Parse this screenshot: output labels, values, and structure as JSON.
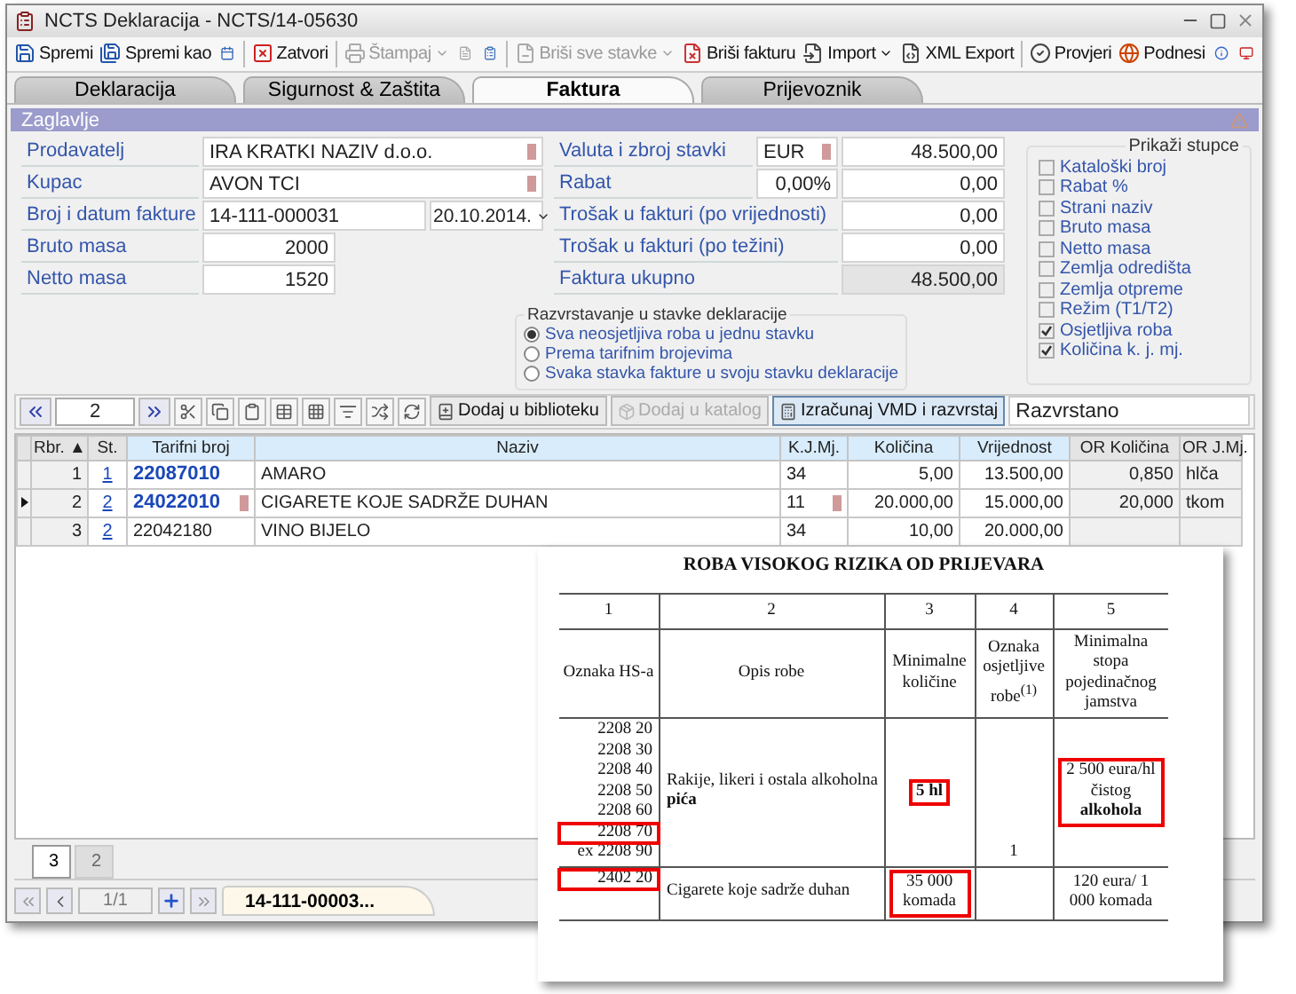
{
  "window": {
    "title": "NCTS Deklaracija - NCTS/14-05630"
  },
  "toolbar": [
    {
      "kind": "button",
      "label": "Spremi",
      "disabled": false,
      "dropdown": false
    },
    {
      "kind": "button",
      "label": "Spremi kao",
      "disabled": false,
      "dropdown": false
    },
    {
      "kind": "icon",
      "disabled": false
    },
    {
      "kind": "separator"
    },
    {
      "kind": "button",
      "label": "Zatvori",
      "disabled": false,
      "dropdown": false
    },
    {
      "kind": "separator"
    },
    {
      "kind": "button",
      "label": "Štampaj",
      "disabled": true,
      "dropdown": true
    },
    {
      "kind": "icon",
      "disabled": true
    },
    {
      "kind": "icon",
      "disabled": false
    },
    {
      "kind": "separator"
    },
    {
      "kind": "button",
      "label": "Briši sve stavke",
      "disabled": true,
      "dropdown": true
    },
    {
      "kind": "button",
      "label": "Briši fakturu",
      "disabled": false,
      "dropdown": false
    },
    {
      "kind": "button",
      "label": "Import",
      "disabled": false,
      "dropdown": true
    },
    {
      "kind": "button",
      "label": "XML Export",
      "disabled": false,
      "dropdown": false
    },
    {
      "kind": "separator"
    },
    {
      "kind": "button",
      "label": "Provjeri",
      "disabled": false,
      "dropdown": false
    },
    {
      "kind": "button",
      "label": "Podnesi",
      "disabled": false,
      "dropdown": false
    },
    {
      "kind": "icon",
      "disabled": false
    },
    {
      "kind": "icon",
      "disabled": false
    }
  ],
  "tabs": [
    {
      "label": "Deklaracija",
      "selected": false
    },
    {
      "label": "Sigurnost & Zaštita",
      "selected": false
    },
    {
      "label": "Faktura",
      "selected": true
    },
    {
      "label": "Prijevoznik",
      "selected": false
    }
  ],
  "section": {
    "title": "Zaglavlje"
  },
  "form": {
    "left": [
      {
        "kind": "text",
        "label": "Prodavatelj",
        "value": "IRA KRATKI NAZIV d.o.o.",
        "marker": true
      },
      {
        "kind": "text",
        "label": "Kupac",
        "value": "AVON TCI",
        "marker": true
      },
      {
        "kind": "dated",
        "label": "Broj i datum fakture",
        "value": "14-111-000031",
        "date": "20.10.2014.",
        "marker": false
      },
      {
        "kind": "number",
        "label": "Bruto masa",
        "value": "2000",
        "marker": false
      },
      {
        "kind": "number",
        "label": "Netto masa",
        "value": "1520",
        "marker": false
      }
    ],
    "right": [
      {
        "label": "Valuta i zbroj stavki",
        "extra": "EUR",
        "value": "48.500,00",
        "marker": true,
        "readonly": false
      },
      {
        "label": "Rabat",
        "extra": "0,00%",
        "value": "0,00",
        "marker": false,
        "readonly": false
      },
      {
        "label": "Trošak u fakturi (po vrijednosti)",
        "value": "0,00",
        "marker": false,
        "readonly": false
      },
      {
        "label": "Trošak u fakturi (po težini)",
        "value": "0,00",
        "marker": false,
        "readonly": false
      },
      {
        "label": "Faktura ukupno",
        "value": "48.500,00",
        "marker": false,
        "readonly": true
      }
    ]
  },
  "sorting": {
    "title": "Razvrstavanje u stavke deklaracije",
    "options": [
      {
        "label": "Sva neosjetljiva roba u jednu stavku",
        "selected": true
      },
      {
        "label": "Prema tarifnim brojevima",
        "selected": false
      },
      {
        "label": "Svaka stavka fakture u svoju stavku deklaracije",
        "selected": false
      }
    ]
  },
  "columns_panel": {
    "title": "Prikaži stupce",
    "items": [
      {
        "label": "Kataloški broj",
        "checked": false
      },
      {
        "label": "Rabat %",
        "checked": false
      },
      {
        "label": "Strani naziv",
        "checked": false
      },
      {
        "label": "Bruto masa",
        "checked": false
      },
      {
        "label": "Netto masa",
        "checked": false
      },
      {
        "label": "Zemlja odredišta",
        "checked": false
      },
      {
        "label": "Zemlja otpreme",
        "checked": false
      },
      {
        "label": "Režim (T1/T2)",
        "checked": false
      },
      {
        "label": "Osjetljiva roba",
        "checked": true
      },
      {
        "label": "Količina k. j. mj.",
        "checked": true
      }
    ]
  },
  "grid_toolbar": {
    "page": "2",
    "buttons": [
      {
        "label": "Dodaj u biblioteku",
        "disabled": false,
        "pressed": false
      },
      {
        "label": "Dodaj u katalog",
        "disabled": true,
        "pressed": false
      },
      {
        "label": "Izračunaj VMD i razvrstaj",
        "disabled": false,
        "pressed": true
      }
    ],
    "status": "Razvrstano"
  },
  "table": {
    "columns": [
      "Rbr. ▲",
      "St.",
      "Tarifni broj",
      "Naziv",
      "K.J.Mj.",
      "Količina",
      "Vrijednost",
      "OR Količina",
      "OR J.Mj."
    ],
    "rows": [
      {
        "current": false,
        "flagged": false,
        "highlighted": true,
        "cells": [
          "1",
          "1",
          "22087010",
          "AMARO",
          "34",
          "5,00",
          "13.500,00",
          "0,850",
          "hlča"
        ]
      },
      {
        "current": true,
        "flagged": true,
        "highlighted": true,
        "cells": [
          "2",
          "2",
          "24022010",
          "CIGARETE KOJE SADRŽE DUHAN",
          "11",
          "20.000,00",
          "15.000,00",
          "20,000",
          "tkom"
        ]
      },
      {
        "current": false,
        "flagged": false,
        "highlighted": false,
        "cells": [
          "3",
          "2",
          "22042180",
          "VINO BIJELO",
          "34",
          "10,00",
          "20.000,00",
          "",
          ""
        ]
      }
    ]
  },
  "bottom_tabs": [
    {
      "label": "3",
      "selected": true
    },
    {
      "label": "2",
      "selected": false
    }
  ],
  "navigator": {
    "position": "1/1",
    "record": "14-111-00003..."
  },
  "document": {
    "title": "ROBA VISOKOG RIZIKA OD PRIJEVARA",
    "numbers": [
      "1",
      "2",
      "3",
      "4",
      "5"
    ],
    "headers": [
      "Oznaka HS-a",
      "Opis robe",
      "Minimalne količine",
      "Oznaka osjetljive robe$^{(1)}$",
      "Minimalna stopa pojedinačnog jamstva"
    ],
    "rows": [
      {
        "codes": [
          {
            "text": "2208 20",
            "highlighted": false
          },
          {
            "text": "2208 30",
            "highlighted": false
          },
          {
            "text": "2208 40",
            "highlighted": false
          },
          {
            "text": "2208 50",
            "highlighted": false
          },
          {
            "text": "2208 60",
            "highlighted": false
          },
          {
            "text": "2208 70",
            "highlighted": true
          },
          {
            "text": "ex 2208 90",
            "highlighted": false
          }
        ],
        "description": "Rakije, likeri i ostala alkoholna **pića**",
        "quantity": "5 hl",
        "quantity_highlighted": true,
        "sensitive": "1",
        "guarantee": "2 500 eura/hl čistog **alkohola**",
        "guarantee_highlighted": true
      },
      {
        "codes": [
          {
            "text": "2402 20",
            "highlighted": true
          }
        ],
        "description": "Cigarete koje sadrže duhan",
        "quantity": "35 000 komada",
        "quantity_highlighted": true,
        "sensitive": "",
        "guarantee": "120 eura/ 1 000 komada",
        "guarantee_highlighted": false
      }
    ]
  }
}
